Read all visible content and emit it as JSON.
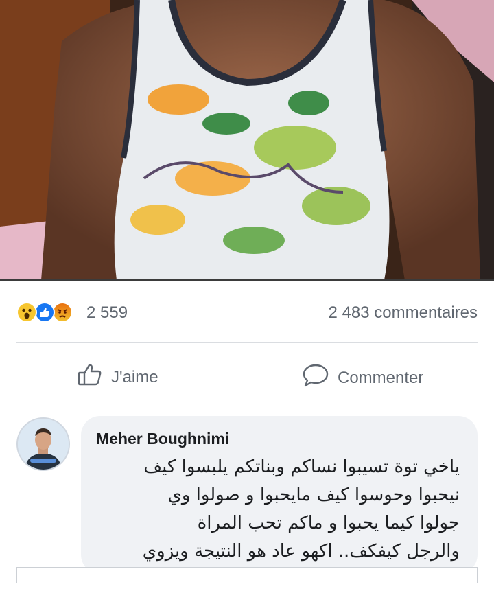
{
  "post": {
    "reaction_icons": [
      "wow-icon",
      "like-icon",
      "angry-icon"
    ],
    "reaction_count": "2 559",
    "comment_count": "2 483 commentaires"
  },
  "actions": {
    "like_label": "J'aime",
    "comment_label": "Commenter",
    "like_icon": "thumbs-up-icon",
    "comment_icon": "speech-bubble-icon"
  },
  "comment": {
    "author": "Meher Boughnimi",
    "lines": [
      "ياخي توة تسيبوا نساكم وبناتكم يلبسوا كيف",
      "نيحبوا وحوسوا كيف مايحبوا و صولوا وي",
      "جولوا كيما يحبوا و ماكم تحب المراة",
      "والرجل كيفكف.. اكهو عاد هو النتيجة ويزوي"
    ]
  },
  "colors": {
    "like_blue": "#1877f2",
    "text_gray": "#606770",
    "bubble_bg": "#f0f2f5",
    "divider": "#dadde1"
  }
}
